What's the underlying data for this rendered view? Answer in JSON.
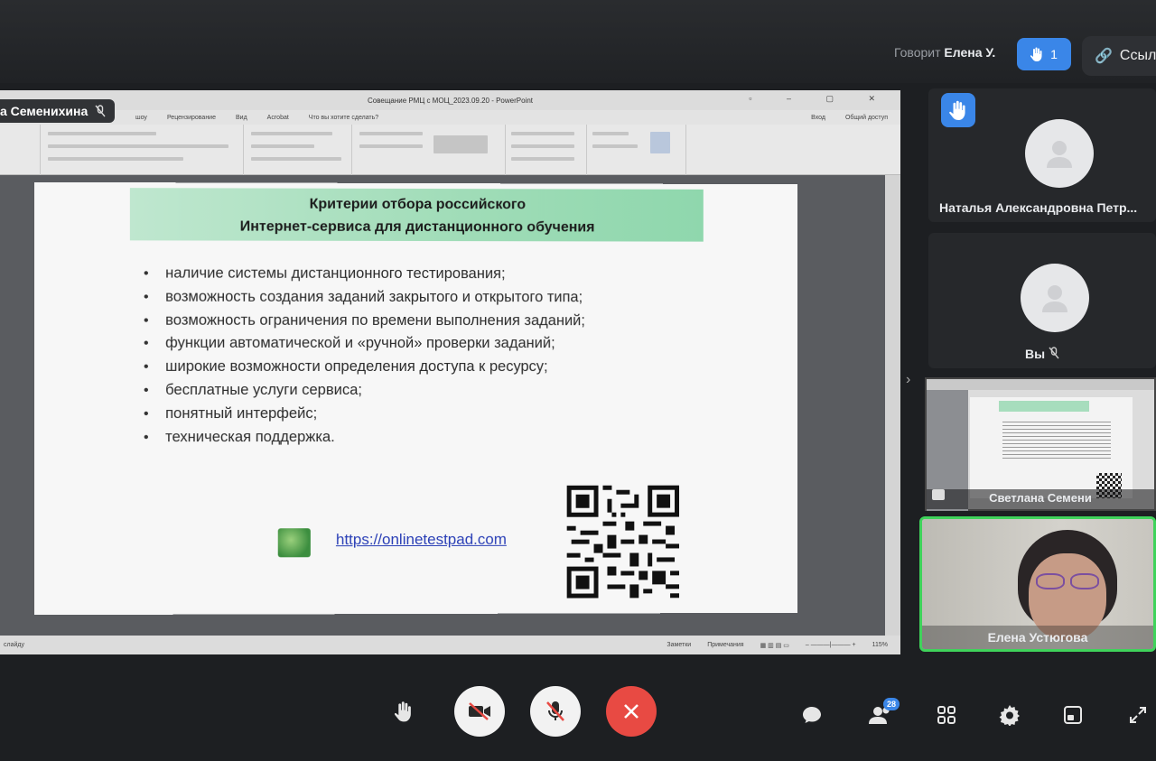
{
  "header": {
    "speaking_prefix": "Говорит",
    "speaking_name": "Елена У.",
    "raised_hands_count": "1",
    "link_button_label": "Ссыл"
  },
  "shared_screen": {
    "presenter_name": "а Семенихина",
    "ppt_window_title": "Совещание РМЦ с МОЦ_2023.09.20 - PowerPoint",
    "ppt_menu": [
      "шоу",
      "Рецензирование",
      "Вид",
      "Acrobat",
      "Что вы хотите сделать?",
      "Вход",
      "Общий доступ"
    ],
    "status_bar": [
      "Заметки",
      "Примечания",
      "115%"
    ],
    "status_left": "слайду",
    "slide": {
      "title_line1": "Критерии отбора российского",
      "title_line2": "Интернет-сервиса для дистанционного обучения",
      "bullets": [
        "наличие системы дистанционного тестирования;",
        "возможность создания заданий закрытого и открытого типа;",
        "возможность ограничения по времени выполнения заданий;",
        "функции автоматической и «ручной» проверки заданий;",
        "широкие возможности определения доступа к ресурсу;",
        "бесплатные услуги сервиса;",
        "понятный интерфейс;",
        "техническая поддержка."
      ],
      "link": "https://onlinetestpad.com"
    }
  },
  "participants": [
    {
      "name": "Наталья Александровна Петр...",
      "hand_raised": true
    },
    {
      "name": "Вы",
      "muted": true
    },
    {
      "name": "Светлана Семени",
      "screen_share": true
    },
    {
      "name": "Елена Устюгова",
      "speaking": true
    }
  ],
  "controls": {
    "participants_count": "28",
    "icons": [
      "raise-hand-icon",
      "camera-off-icon",
      "mic-off-icon",
      "end-call-icon",
      "chat-icon",
      "participants-icon",
      "grid-view-icon",
      "settings-icon",
      "pip-icon",
      "fullscreen-icon"
    ]
  },
  "colors": {
    "accent_blue": "#3a86e8",
    "end_call_red": "#e84a43",
    "speaker_green": "#3fd35b"
  }
}
